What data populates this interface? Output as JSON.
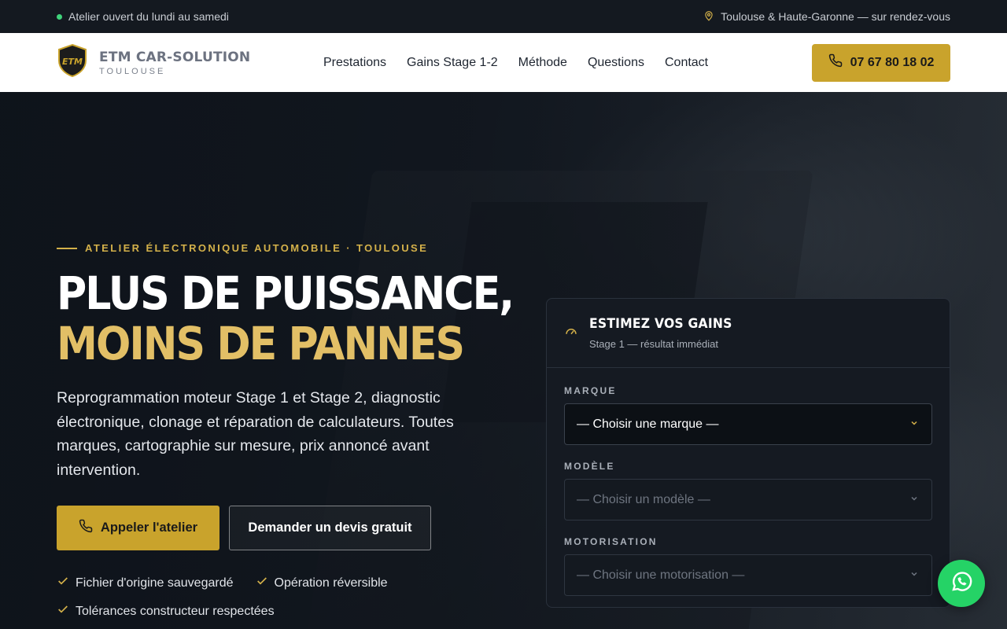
{
  "topbar": {
    "hours": "Atelier ouvert du lundi au samedi",
    "location": "Toulouse & Haute-Garonne — sur rendez-vous"
  },
  "header": {
    "logo_text": "ETM",
    "brand_name": "ETM CAR-SOLUTION",
    "brand_city": "TOULOUSE",
    "nav": [
      "Prestations",
      "Gains Stage 1-2",
      "Méthode",
      "Questions",
      "Contact"
    ],
    "phone": "07 67 80 18 02"
  },
  "hero": {
    "eyebrow": "ATELIER ÉLECTRONIQUE AUTOMOBILE · TOULOUSE",
    "title_line1": "PLUS DE PUISSANCE,",
    "title_line2": "MOINS DE PANNES",
    "lead": "Reprogrammation moteur Stage 1 et Stage 2, diagnostic électronique, clonage et réparation de calculateurs. Toutes marques, cartographie sur mesure, prix annoncé avant intervention.",
    "cta_primary": "Appeler l'atelier",
    "cta_secondary": "Demander un devis gratuit",
    "checks": [
      "Fichier d'origine sauvegardé",
      "Opération réversible",
      "Tolérances constructeur respectées"
    ]
  },
  "estimator": {
    "title": "ESTIMEZ VOS GAINS",
    "subtitle": "Stage 1 — résultat immédiat",
    "fields": [
      {
        "label": "MARQUE",
        "value": "— Choisir une marque —",
        "enabled": true
      },
      {
        "label": "MODÈLE",
        "value": "— Choisir un modèle —",
        "enabled": false
      },
      {
        "label": "MOTORISATION",
        "value": "— Choisir une motorisation —",
        "enabled": false
      }
    ]
  },
  "colors": {
    "accent": "#c9a32c",
    "accent_text": "#e2bf66",
    "whatsapp": "#25d366",
    "status_dot": "#3fd37a"
  },
  "icons": {
    "status": "green-dot",
    "location": "map-pin-icon",
    "phone": "phone-icon",
    "check": "check-icon",
    "gauge": "gauge-icon",
    "chevron": "chevron-down-icon",
    "whatsapp": "whatsapp-icon"
  }
}
